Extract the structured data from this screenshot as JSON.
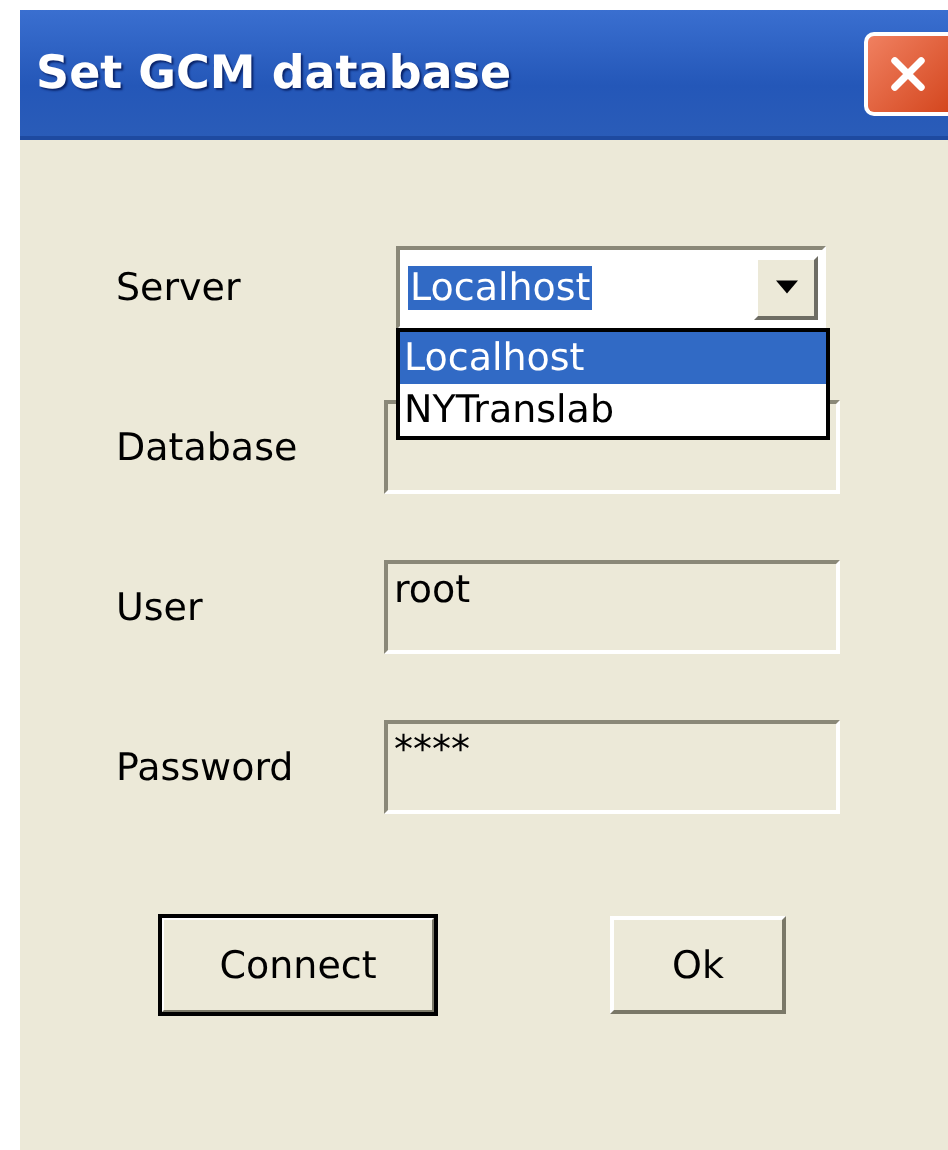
{
  "window": {
    "title": "Set GCM database"
  },
  "fields": [
    {
      "label": "Server",
      "kind": "combo",
      "value": "Localhost",
      "highlighted": true,
      "open": true,
      "options": [
        {
          "label": "Localhost",
          "selected": true
        },
        {
          "label": "NYTranslab",
          "selected": false
        }
      ]
    },
    {
      "label": "Database",
      "kind": "text"
    },
    {
      "label": "User",
      "kind": "text",
      "value": "root"
    },
    {
      "label": "Password",
      "kind": "text",
      "value": "****"
    }
  ],
  "buttons": [
    {
      "label": "Connect",
      "default": true
    },
    {
      "label": "Ok",
      "default": false
    }
  ]
}
